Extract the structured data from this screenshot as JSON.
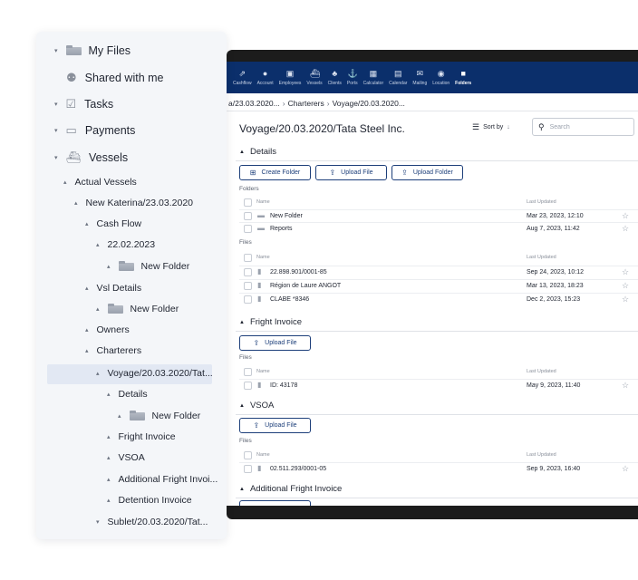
{
  "nav": {
    "items": [
      {
        "label": "Cashflow",
        "icon": "cashflow-icon",
        "glyph": "⇗"
      },
      {
        "label": "Account",
        "icon": "account-icon",
        "glyph": "●"
      },
      {
        "label": "Employees",
        "icon": "employees-icon",
        "glyph": "▣"
      },
      {
        "label": "Vessels",
        "icon": "vessels-icon",
        "glyph": "⛴"
      },
      {
        "label": "Clients",
        "icon": "clients-icon",
        "glyph": "♣"
      },
      {
        "label": "Ports",
        "icon": "ports-icon",
        "glyph": "⚓"
      },
      {
        "label": "Calculator",
        "icon": "calculator-icon",
        "glyph": "▦"
      },
      {
        "label": "Calendar",
        "icon": "calendar-icon",
        "glyph": "▤"
      },
      {
        "label": "Mailing",
        "icon": "mailing-icon",
        "glyph": "✉"
      },
      {
        "label": "Location",
        "icon": "location-icon",
        "glyph": "◉"
      },
      {
        "label": "Folders",
        "icon": "folders-icon",
        "glyph": "■",
        "active": true
      }
    ]
  },
  "breadcrumb": {
    "part1": "a/23.03.2020...",
    "part2": "Charterers",
    "part3": "Voyage/20.03.2020...",
    "separator": "›"
  },
  "page": {
    "title": "Voyage/20.03.2020/Tata Steel Inc.",
    "sort_label": "Sort by",
    "sort_arrow": "↓",
    "search_placeholder": "Search"
  },
  "labels": {
    "folders": "Folders",
    "files": "Files",
    "col_name": "Name",
    "col_updated": "Last Updated"
  },
  "sections": {
    "details": {
      "title": "Details",
      "btn_create_folder": "Create Folder",
      "btn_upload_file": "Upload File",
      "btn_upload_folder": "Upload Folder",
      "folders": [
        {
          "name": "New Folder",
          "date": "Mar 23, 2023, 12:10"
        },
        {
          "name": "Reports",
          "date": "Aug 7, 2023, 11:42"
        }
      ],
      "files": [
        {
          "name": "22.898.901/0001-85",
          "date": "Sep 24, 2023, 10:12"
        },
        {
          "name": "Région de Laure ANGOT",
          "date": "Mar 13, 2023, 18:23"
        },
        {
          "name": "CLABE *8346",
          "date": "Dec 2, 2023, 15:23"
        }
      ]
    },
    "fright_invoice": {
      "title": "Fright Invoice",
      "btn_upload_file": "Upload File",
      "files": [
        {
          "name": "ID: 43178",
          "date": "May 9, 2023, 11:40"
        }
      ]
    },
    "vsoa": {
      "title": "VSOA",
      "btn_upload_file": "Upload File",
      "files": [
        {
          "name": "02.511.293/0001-05",
          "date": "Sep 9, 2023, 16:40"
        }
      ]
    },
    "additional_fright_invoice": {
      "title": "Additional Fright Invoice"
    }
  },
  "tree": {
    "my_files": "My Files",
    "shared_with_me": "Shared with me",
    "tasks": "Tasks",
    "payments": "Payments",
    "vessels": "Vessels",
    "actual_vessels": "Actual Vessels",
    "new_katerina": "New Katerina/23.03.2020",
    "cash_flow": "Cash Flow",
    "date_22": "22.02.2023",
    "new_folder_1": "New Folder",
    "vsl_details": "Vsl Details",
    "new_folder_2": "New Folder",
    "owners": "Owners",
    "charterers": "Charterers",
    "voyage": "Voyage/20.03.2020/Tat...",
    "details": "Details",
    "new_folder_3": "New Folder",
    "fright_invoice": "Fright Invoice",
    "vsoa": "VSOA",
    "additional_fright": "Additional Fright Invoi...",
    "detention_invoice": "Detention Invoice",
    "sublet": "Sublet/20.03.2020/Tat..."
  },
  "colors": {
    "nav_bg": "#0b2f6b",
    "accent": "#1d3f7a",
    "tree_selected": "#e2e8f3"
  }
}
